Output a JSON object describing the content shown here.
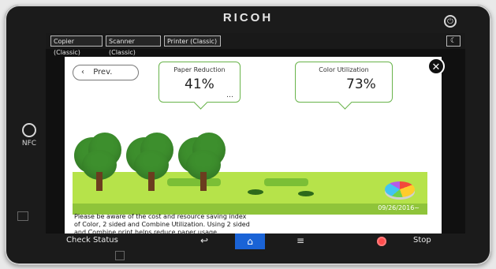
{
  "device": {
    "brand": "RICOH"
  },
  "tabs": [
    {
      "label": "Copier (Classic)"
    },
    {
      "label": "Scanner (Classic)"
    },
    {
      "label": "Printer (Classic)"
    }
  ],
  "main": {
    "prev_label": "Prev.",
    "paper_reduction": {
      "label": "Paper Reduction",
      "value": "41%"
    },
    "color_utilization": {
      "label": "Color Utilization",
      "value": "73%"
    },
    "date": "09/26/2016~",
    "info_text": [
      "Please be aware of the cost and resource saving index",
      "of Color, 2 sided and Combine Utilization. Using 2 sided",
      "and Combine print helps reduce paper usage."
    ]
  },
  "bottombar": {
    "check_status": "Check Status",
    "stop": "Stop"
  },
  "icons": {
    "nfc_label": "NFC"
  },
  "colors": {
    "accent_green": "#68b34a",
    "home_blue": "#1a63d6",
    "stop_red": "#ff4d4d"
  }
}
